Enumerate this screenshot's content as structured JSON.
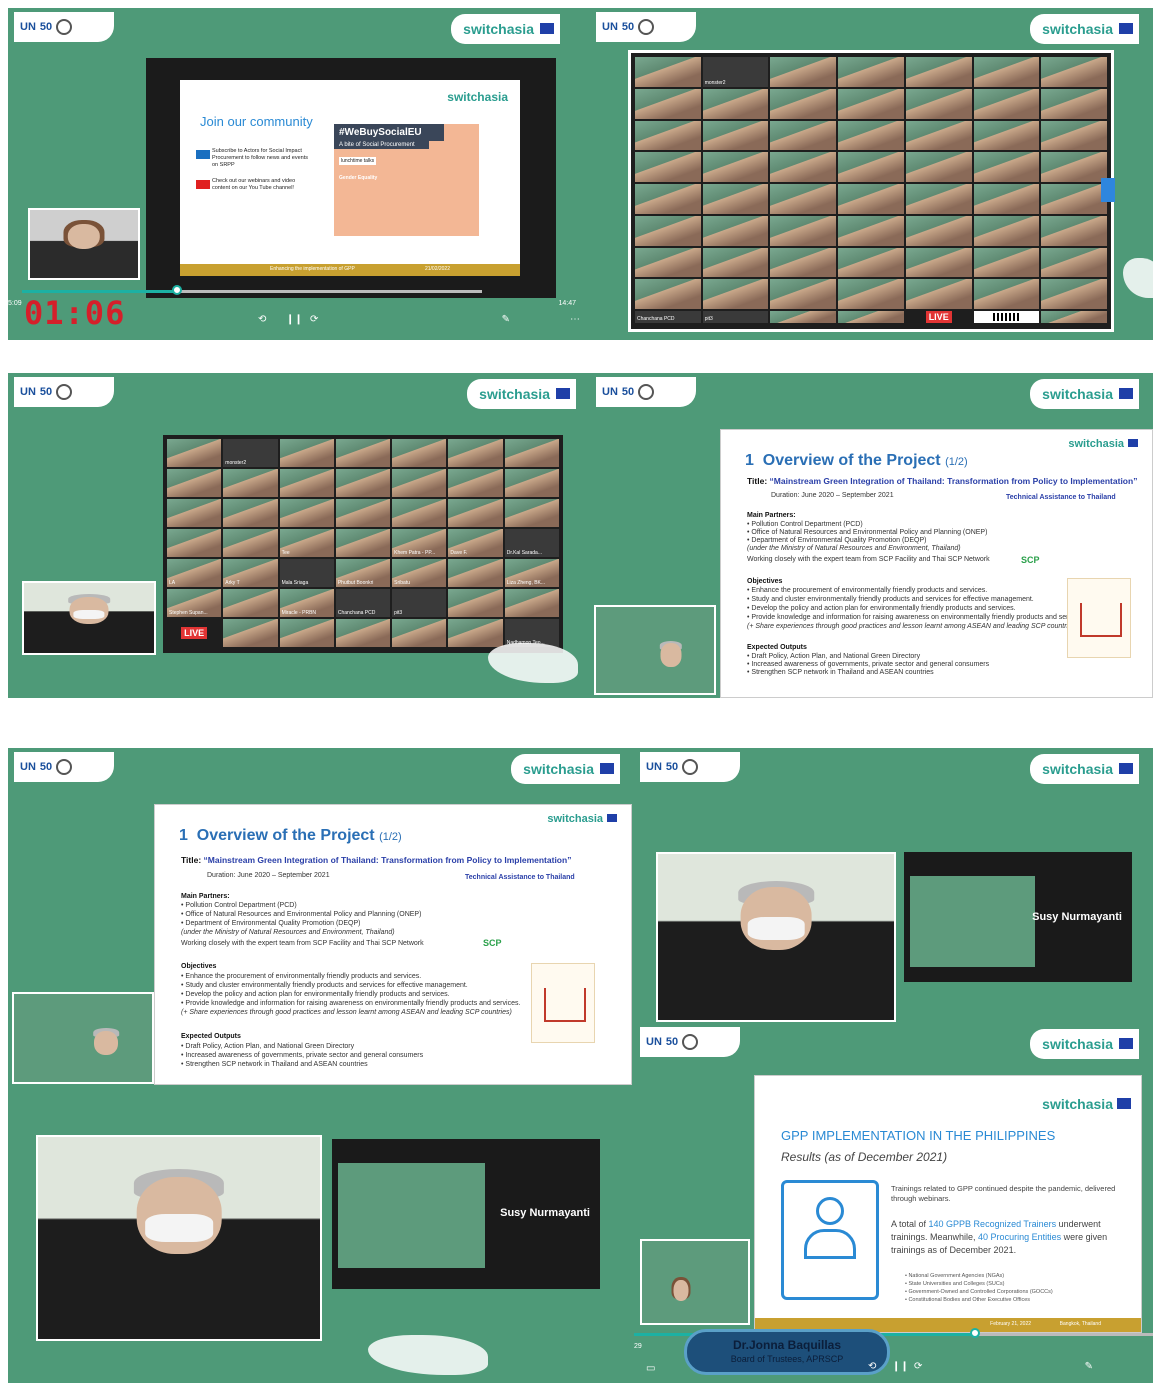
{
  "logos": {
    "un": "UN",
    "un_fifty": "50",
    "switch": "switchasia"
  },
  "shot1": {
    "slide_title": "Join our community",
    "brand": "switchasia",
    "item1": "Subscribe to Actors for Social Impact Procurement to follow news and events on SRPP",
    "item2": "Check out our webinars and video content on our You Tube channel!",
    "banner_tag": "#WeBuySocialEU",
    "banner_sub": "A bite of Social Procurement",
    "banner_small": "lunchtime talks",
    "banner_topic": "Gender Equality",
    "footer": "Enhancing the implementation of GPP",
    "footer_date": "21/02/2022",
    "timer": "01:06",
    "time_left": "5:09",
    "time_right": "14:47"
  },
  "shot2": {
    "tiles": [
      "",
      "monster2",
      "",
      "",
      "",
      "",
      "",
      "",
      "",
      "",
      "",
      "",
      "",
      "",
      "",
      "",
      "",
      "",
      "",
      "",
      "",
      "",
      "",
      "",
      "",
      "",
      "",
      "",
      "",
      "",
      "",
      "",
      "",
      "",
      "",
      "",
      "",
      "",
      "",
      "",
      "",
      "",
      "",
      "",
      "",
      "",
      "",
      "",
      "",
      "",
      "",
      "",
      "",
      "",
      "",
      "",
      "Chanchana PCD",
      "pit3",
      "",
      "",
      "LIVE",
      "",
      "",
      ""
    ]
  },
  "shot3": {
    "tiles": [
      "",
      "monster2",
      "",
      "",
      "",
      "",
      "",
      "",
      "",
      "",
      "",
      "",
      "",
      "",
      "",
      "",
      "",
      "",
      "",
      "",
      "",
      "",
      "",
      "Tee",
      "",
      "Khem Patra - PP...",
      "Dave F.",
      "Dr.Kal Sarada...",
      "LA",
      "Arky T",
      "Mala Sriaga",
      "Phutbut Boonkri",
      "Sribatu",
      "",
      "Liza Zheng, BK...",
      "Stephen Supan...",
      "",
      "Miracle - PRBN",
      "Chanchana PCD",
      "pit3",
      "",
      "",
      "LIVE",
      "",
      "",
      "",
      "",
      "",
      "Nadhamon Teo...",
      "",
      "",
      ""
    ]
  },
  "overview": {
    "num": "1",
    "title": "Overview of the Project",
    "part": "(1/2)",
    "label_title": "Title:",
    "title_quote": "“Mainstream Green Integration of Thailand: Transformation from Policy to Implementation”",
    "duration": "Duration: June 2020 – September 2021",
    "ta": "Technical Assistance to Thailand",
    "partners_h": "Main Partners:",
    "p1": "• Pollution Control Department (PCD)",
    "p2": "• Office of Natural Resources and Environmental Policy and Planning (ONEP)",
    "p3": "• Department of Environmental Quality Promotion (DEQP)",
    "p4": "(under the Ministry of Natural Resources and Environment, Thailand)",
    "p5": "Working closely with the expert team from SCP Facility and Thai SCP Network",
    "scp": "SCP",
    "obj_h": "Objectives",
    "o1": "• Enhance the procurement of environmentally friendly products and services.",
    "o2": "• Study and cluster environmentally friendly products and services for effective management.",
    "o3": "• Develop the policy and action plan for environmentally friendly products and services.",
    "o4": "• Provide knowledge and information for raising awareness on environmentally friendly products and services.",
    "o5": "(+ Share experiences through good practices and lesson learnt among ASEAN and leading SCP countries)",
    "out_h": "Expected Outputs",
    "e1": "• Draft Policy, Action Plan, and National Green Directory",
    "e2": "• Increased awareness of governments, private sector and general consumers",
    "e3": "• Strengthen SCP network in Thailand and ASEAN countries"
  },
  "speaker": {
    "name": "Susy Nurmayanti"
  },
  "shot8": {
    "brand": "switchasia",
    "title": "GPP IMPLEMENTATION IN THE PHILIPPINES",
    "subtitle": "Results (as of December 2021)",
    "para1": "Trainings related to GPP continued despite the pandemic, delivered through webinars.",
    "para2a": "A total of ",
    "para2b": "140 GPPB Recognized Trainers",
    "para2c": " underwent trainings. Meanwhile, ",
    "para2d": "40 Procuring Entities",
    "para2e": " were given trainings as of December 2021.",
    "b1": "• National Government Agencies (NGAs)",
    "b2": "• State Universities and Colleges (SUCs)",
    "b3": "• Government-Owned and Controlled Corporations (GOCCs)",
    "b4": "• Constitutional Bodies and Other Executive Offices",
    "footer_date": "February 21, 2022",
    "footer_place": "Bangkok, Thailand",
    "lower_name": "Dr.Jonna Baquillas",
    "lower_role": "Board of Trustees, APRSCP",
    "time_left": "29"
  }
}
